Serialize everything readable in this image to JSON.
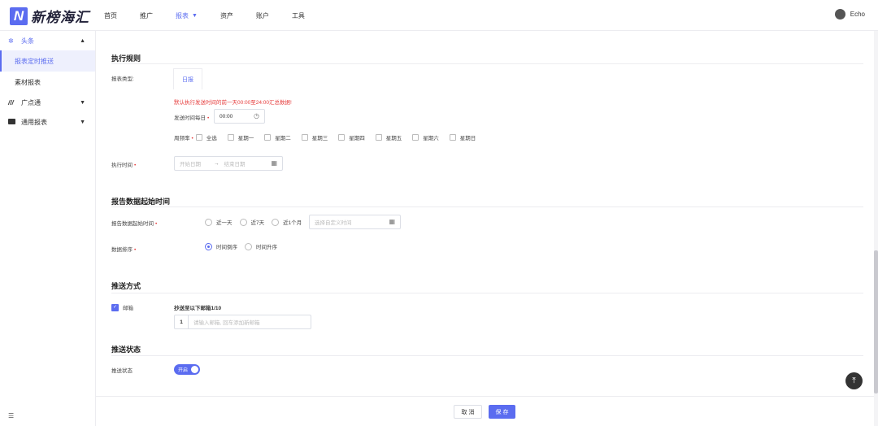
{
  "brand": {
    "logo_letter": "N",
    "name": "新榜海汇"
  },
  "nav": {
    "items": [
      {
        "label": "首页"
      },
      {
        "label": "推广"
      },
      {
        "label": "报表",
        "active": true
      },
      {
        "label": "资产"
      },
      {
        "label": "账户"
      },
      {
        "label": "工具"
      }
    ]
  },
  "user": {
    "name": "Echo"
  },
  "sidebar": {
    "group1": {
      "label": "头条",
      "icon": "sparkle-icon"
    },
    "sub1": {
      "label": "报表定时推送"
    },
    "sub2": {
      "label": "素材报表"
    },
    "group2": {
      "label": "广点通",
      "icon": "brand-icon"
    },
    "group3": {
      "label": "通用报表",
      "icon": "ad-icon"
    },
    "bottom_icon": "collapse-icon"
  },
  "exec_rules": {
    "title": "执行规则",
    "report_type_label": "报表类型:",
    "report_type_tab": "日报",
    "warning": "默认执行发送时间的前一天00:00至24:00汇总数据!",
    "send_time_label": "发送时间每日",
    "send_time_value": "00:00",
    "frequency_label": "周频率",
    "weekdays": [
      "全选",
      "星期一",
      "星期二",
      "星期三",
      "星期四",
      "星期五",
      "星期六",
      "星期日"
    ],
    "exec_time_label": "执行时间",
    "start_placeholder": "开始日期",
    "arrow": "→",
    "end_placeholder": "结束日期"
  },
  "report_start": {
    "title": "报告数据起始时间",
    "start_label": "报告数据起始时间",
    "range_options": [
      "近一天",
      "近7天",
      "近1个月"
    ],
    "custom_placeholder": "选择自定义时间",
    "sort_label": "数据排序",
    "sort_options": [
      "时间倒序",
      "时间升序"
    ],
    "sort_selected": 0
  },
  "push_method": {
    "title": "推送方式",
    "email_label": "邮箱",
    "email_checked": true,
    "cc_label": "抄送至以下邮箱1/10",
    "email_index": "1",
    "email_placeholder": "请输入邮箱, 回车添加新邮箱"
  },
  "push_status": {
    "title": "推送状态",
    "label": "推送状态",
    "toggle_text": "开启",
    "enabled": true
  },
  "footer": {
    "cancel": "取 消",
    "save": "保 存"
  },
  "colors": {
    "accent": "#5b6cf0",
    "danger": "#e63b3b"
  }
}
